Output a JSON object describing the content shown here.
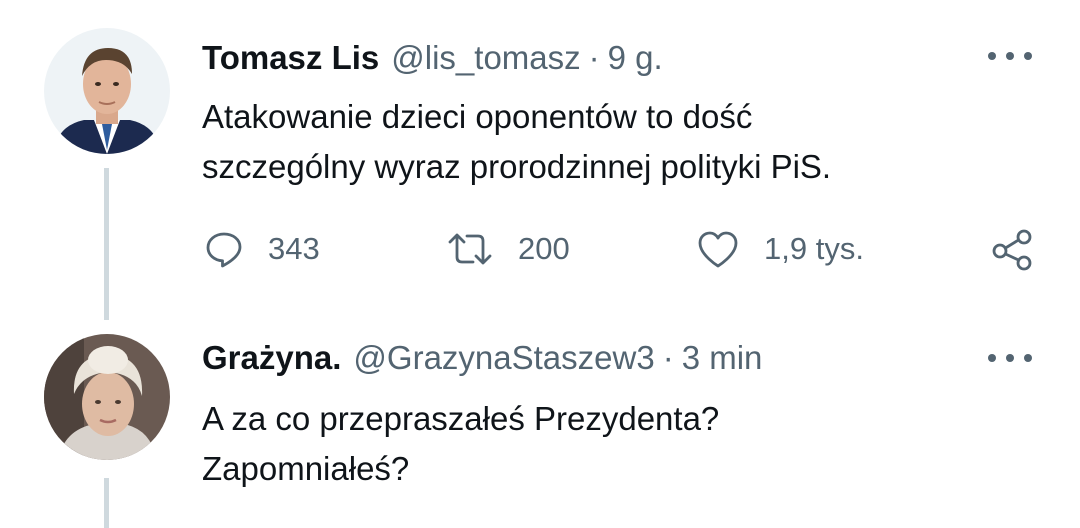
{
  "tweets": [
    {
      "name": "Tomasz Lis",
      "handle": "@lis_tomasz",
      "separator": "·",
      "time": "9 g.",
      "lines": [
        "Atakowanie dzieci oponentów to dość",
        "szczególny wyraz prorodzinnej polityki PiS."
      ],
      "actions": {
        "replies": "343",
        "retweets": "200",
        "likes": "1,9 tys."
      },
      "icons": [
        "avatar",
        "more-icon",
        "reply-icon",
        "retweet-icon",
        "like-icon",
        "share-icon"
      ]
    },
    {
      "name": "Grażyna.",
      "handle": "@GrazynaStaszew3",
      "separator": "·",
      "time": "3 min",
      "lines": [
        "A za co przepraszałeś Prezydenta?",
        "Zapomniałeś?"
      ],
      "icons": [
        "avatar",
        "more-icon"
      ]
    }
  ],
  "colors": {
    "text_primary": "#0f1419",
    "text_secondary": "#536471",
    "thread_line": "#cfd9de"
  }
}
